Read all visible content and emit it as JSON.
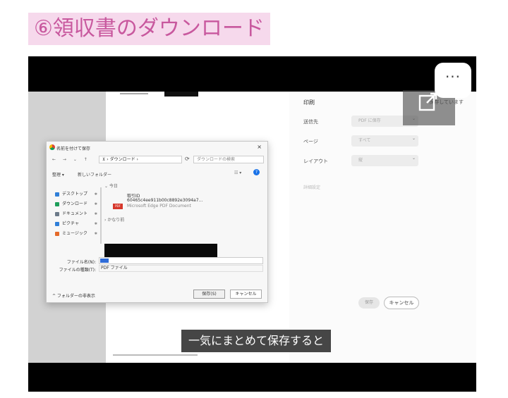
{
  "heading": "⑥領収書のダウンロード",
  "video": {
    "subtitle": "一気にまとめて保存すると",
    "more_label": "···"
  },
  "save_dialog": {
    "title": "名前を付けて保存",
    "close": "×",
    "nav": "← → ⌄ ↑",
    "path": "⊻ › ダウンロード ›",
    "search_placeholder": "ダウンロードの検索",
    "organize": "整理 ▾",
    "new_folder": "新しいフォルダー",
    "view": "☷ ▾",
    "help": "?",
    "sidebar": [
      {
        "label": "デスクトップ",
        "color": "#2f7fd8"
      },
      {
        "label": "ダウンロード",
        "color": "#1e9e5a"
      },
      {
        "label": "ドキュメント",
        "color": "#6c7a89"
      },
      {
        "label": "ピクチャ",
        "color": "#2f7fd8"
      },
      {
        "label": "ミュージック",
        "color": "#e46a2a"
      }
    ],
    "group_today": "⌄ 今日",
    "file_line1": "取引ID",
    "file_line2": "60465c4ee911b00c8892e3094a7...",
    "file_type": "Microsoft Edge PDF Document",
    "pdf_badge": "PDF",
    "group_older": "› かなり前",
    "label_filename": "ファイル名(N):",
    "label_filetype": "ファイルの種類(T):",
    "filetype_value": "PDF ファイル",
    "hide_folders": "^ フォルダーの非表示",
    "save_button": "保存(S)",
    "cancel_button": "キャンセル"
  },
  "print_panel": {
    "title": "印刷",
    "save_hint": "保存しています",
    "destination_label": "送信先",
    "destination_value": "PDF に保存",
    "pages_label": "ページ",
    "pages_value": "すべて",
    "layout_label": "レイアウト",
    "layout_value": "縦",
    "advanced_label": "詳細設定",
    "print_button": "保存",
    "cancel_button": "キャンセル"
  }
}
